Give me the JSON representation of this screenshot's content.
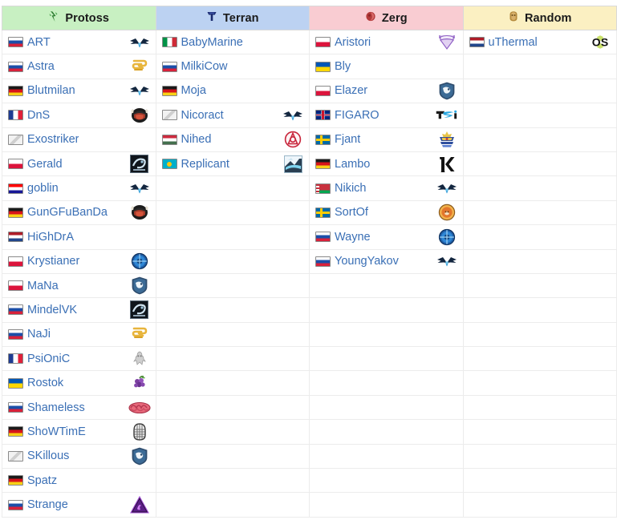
{
  "table": {
    "columns": [
      {
        "id": "protoss",
        "label": "Protoss",
        "icon": "protoss-race-icon",
        "header_bg": "#c8f0c2"
      },
      {
        "id": "terran",
        "label": "Terran",
        "icon": "terran-race-icon",
        "header_bg": "#bcd2f2"
      },
      {
        "id": "zerg",
        "label": "Zerg",
        "icon": "zerg-race-icon",
        "header_bg": "#f9ccd2"
      },
      {
        "id": "random",
        "label": "Random",
        "icon": "random-race-icon",
        "header_bg": "#fbf0c2"
      }
    ],
    "rows": 20,
    "protoss": [
      {
        "name": "ART",
        "flag": "ru",
        "flag_name": "russia-flag",
        "team": "team-logo-alpha-x"
      },
      {
        "name": "Astra",
        "flag": "ru",
        "flag_name": "russia-flag",
        "team": "team-logo-yellow-dragon"
      },
      {
        "name": "Blutmilan",
        "flag": "de",
        "flag_name": "germany-flag",
        "team": "team-logo-alpha-x"
      },
      {
        "name": "DnS",
        "flag": "fr",
        "flag_name": "france-flag",
        "team": "team-logo-viking"
      },
      {
        "name": "Exostriker",
        "flag": "none",
        "flag_name": "no-flag",
        "team": ""
      },
      {
        "name": "Gerald",
        "flag": "pl",
        "flag_name": "poland-flag",
        "team": "team-logo-dark-square"
      },
      {
        "name": "goblin",
        "flag": "hr",
        "flag_name": "croatia-flag",
        "team": "team-logo-alpha-x"
      },
      {
        "name": "GunGFuBanDa",
        "flag": "de",
        "flag_name": "germany-flag",
        "team": "team-logo-viking"
      },
      {
        "name": "HiGhDrA",
        "flag": "nl",
        "flag_name": "netherlands-flag",
        "team": ""
      },
      {
        "name": "Krystianer",
        "flag": "pl",
        "flag_name": "poland-flag",
        "team": "team-logo-blue-orb"
      },
      {
        "name": "MaNa",
        "flag": "pl",
        "flag_name": "poland-flag",
        "team": "team-logo-liquid"
      },
      {
        "name": "MindelVK",
        "flag": "ru",
        "flag_name": "russia-flag",
        "team": "team-logo-dark-square"
      },
      {
        "name": "NaJi",
        "flag": "ru",
        "flag_name": "russia-flag",
        "team": "team-logo-yellow-dragon"
      },
      {
        "name": "PsiOniC",
        "flag": "fr",
        "flag_name": "france-flag",
        "team": "team-logo-grey-creature"
      },
      {
        "name": "Rostok",
        "flag": "ua",
        "flag_name": "ukraine-flag",
        "team": "team-logo-purple-grape"
      },
      {
        "name": "Shameless",
        "flag": "ru",
        "flag_name": "russia-flag",
        "team": "team-logo-brain"
      },
      {
        "name": "ShoWTimE",
        "flag": "de",
        "flag_name": "germany-flag",
        "team": "team-logo-helmet"
      },
      {
        "name": "SKillous",
        "flag": "none",
        "flag_name": "no-flag",
        "team": "team-logo-liquid"
      },
      {
        "name": "Spatz",
        "flag": "de",
        "flag_name": "germany-flag",
        "team": ""
      },
      {
        "name": "Strange",
        "flag": "ru",
        "flag_name": "russia-flag",
        "team": "team-logo-purple-triangle"
      }
    ],
    "terran": [
      {
        "name": "BabyMarine",
        "flag": "it",
        "flag_name": "italy-flag",
        "team": ""
      },
      {
        "name": "MilkiCow",
        "flag": "ru",
        "flag_name": "russia-flag",
        "team": ""
      },
      {
        "name": "Moja",
        "flag": "de",
        "flag_name": "germany-flag",
        "team": ""
      },
      {
        "name": "Nicoract",
        "flag": "none",
        "flag_name": "no-flag",
        "team": "team-logo-alpha-x"
      },
      {
        "name": "Nihed",
        "flag": "hu",
        "flag_name": "hungary-flag",
        "team": "team-logo-red-circle"
      },
      {
        "name": "Replicant",
        "flag": "kz",
        "flag_name": "kazakhstan-flag",
        "team": "team-logo-light-square"
      }
    ],
    "zerg": [
      {
        "name": "Aristori",
        "flag": "pl",
        "flag_name": "poland-flag",
        "team": "team-logo-purple-shield"
      },
      {
        "name": "Bly",
        "flag": "ua",
        "flag_name": "ukraine-flag",
        "team": ""
      },
      {
        "name": "Elazer",
        "flag": "pl",
        "flag_name": "poland-flag",
        "team": "team-logo-liquid"
      },
      {
        "name": "FIGARO",
        "flag": "gb",
        "flag_name": "united-kingdom-flag",
        "team": "team-logo-tsi"
      },
      {
        "name": "Fjant",
        "flag": "se",
        "flag_name": "sweden-flag",
        "team": "team-logo-gold-crown"
      },
      {
        "name": "Lambo",
        "flag": "de",
        "flag_name": "germany-flag",
        "team": "team-logo-black-k"
      },
      {
        "name": "Nikich",
        "flag": "by",
        "flag_name": "belarus-flag",
        "team": "team-logo-alpha-x"
      },
      {
        "name": "SortOf",
        "flag": "se",
        "flag_name": "sweden-flag",
        "team": "team-logo-orange-circle"
      },
      {
        "name": "Wayne",
        "flag": "ru",
        "flag_name": "russia-flag",
        "team": "team-logo-blue-orb"
      },
      {
        "name": "YoungYakov",
        "flag": "ru",
        "flag_name": "russia-flag",
        "team": "team-logo-alpha-x"
      }
    ],
    "random": [
      {
        "name": "uThermal",
        "flag": "nl",
        "flag_name": "netherlands-flag",
        "team": "team-logo-os"
      }
    ]
  }
}
